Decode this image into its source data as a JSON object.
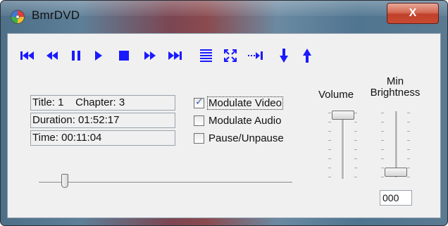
{
  "window": {
    "title": "BmrDVD",
    "close_label": "X"
  },
  "toolbar": {
    "color": "#1a1aff",
    "buttons": [
      {
        "name": "skip-to-start-icon"
      },
      {
        "name": "rewind-icon"
      },
      {
        "name": "pause-icon"
      },
      {
        "name": "play-icon"
      },
      {
        "name": "stop-icon"
      },
      {
        "name": "fast-forward-icon"
      },
      {
        "name": "skip-to-end-icon"
      },
      {
        "name": "menu-list-icon"
      },
      {
        "name": "fullscreen-icon"
      },
      {
        "name": "next-chapter-icon"
      },
      {
        "name": "arrow-down-icon"
      },
      {
        "name": "arrow-up-icon"
      }
    ]
  },
  "info": {
    "title_chapter": "Title: 1    Chapter: 3",
    "duration": "Duration: 01:52:17",
    "time": "Time: 00:11:04"
  },
  "options": {
    "modulate_video": {
      "label": "Modulate Video",
      "checked": true
    },
    "modulate_audio": {
      "label": "Modulate Audio",
      "checked": false
    },
    "pause_unpause": {
      "label": "Pause/Unpause",
      "checked": false
    }
  },
  "seek": {
    "position": 0.1
  },
  "volume": {
    "label": "Volume",
    "level": 1.0
  },
  "brightness": {
    "label_line1": "Min",
    "label_line2": "Brightness",
    "level": 0.0,
    "value": "000"
  }
}
